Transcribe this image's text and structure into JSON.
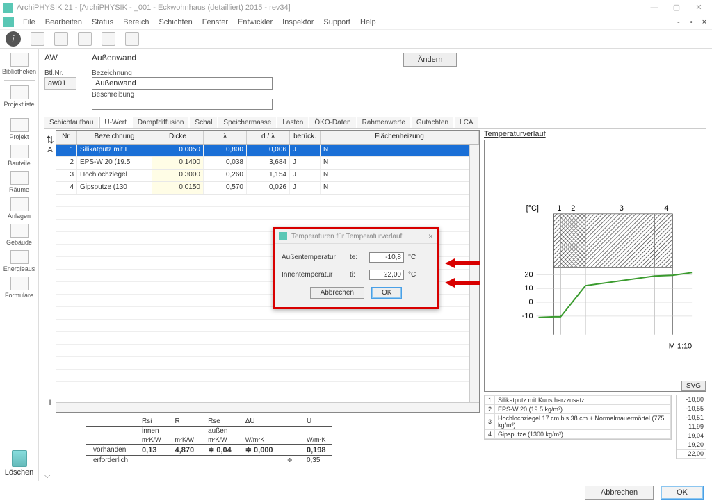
{
  "window": {
    "title": "ArchiPHYSIK 21 - [ArchiPHYSIK - _001 - Eckwohnhaus (detailliert) 2015 - rev34]"
  },
  "menu": [
    "File",
    "Bearbeiten",
    "Status",
    "Bereich",
    "Schichten",
    "Fenster",
    "Entwickler",
    "Inspektor",
    "Support",
    "Help"
  ],
  "leftnav": [
    {
      "label": "Bibliotheken"
    },
    {
      "label": "Projektliste"
    },
    {
      "label": "Projekt"
    },
    {
      "label": "Bauteile"
    },
    {
      "label": "Räume"
    },
    {
      "label": "Anlagen"
    },
    {
      "label": "Gebäude"
    },
    {
      "label": "Energieaus"
    },
    {
      "label": "Formulare"
    }
  ],
  "leftnav_delete": "Löschen",
  "form": {
    "code": "AW",
    "title": "Außenwand",
    "btlnr_label": "Btl.Nr.",
    "btlnr": "aw01",
    "bez_label": "Bezeichnung",
    "bez": "Außenwand",
    "beschr_label": "Beschreibung",
    "beschr": "",
    "change": "Ändern"
  },
  "tabs": [
    "Schichtaufbau",
    "U-Wert",
    "Dampfdiffusion",
    "Schal",
    "Speichermasse",
    "Lasten",
    "ÖKO-Daten",
    "Rahmenwerte",
    "Gutachten",
    "LCA"
  ],
  "active_tab": "U-Wert",
  "grid": {
    "side_top": "A",
    "side_bot": "I",
    "headers": [
      "Nr.",
      "Bezeichnung",
      "Dicke",
      "λ",
      "d / λ",
      "berück.",
      "Flächenheizung"
    ],
    "rows": [
      {
        "nr": "1",
        "bez": "Silikatputz mit I",
        "dicke": "0,0050",
        "lam": "0,800",
        "dl": "0,006",
        "ber": "J",
        "fl": "N",
        "sel": true
      },
      {
        "nr": "2",
        "bez": "EPS-W 20 (19.5",
        "dicke": "0,1400",
        "lam": "0,038",
        "dl": "3,684",
        "ber": "J",
        "fl": "N"
      },
      {
        "nr": "3",
        "bez": "Hochlochziegel",
        "dicke": "0,3000",
        "lam": "0,260",
        "dl": "1,154",
        "ber": "J",
        "fl": "N"
      },
      {
        "nr": "4",
        "bez": "Gipsputze (130",
        "dicke": "0,0150",
        "lam": "0,570",
        "dl": "0,026",
        "ber": "J",
        "fl": "N"
      }
    ]
  },
  "dialog": {
    "title": "Temperaturen für Temperaturverlauf",
    "rows": [
      {
        "label": "Außentemperatur",
        "key": "te:",
        "val": "-10,8",
        "unit": "°C"
      },
      {
        "label": "Innentemperatur",
        "key": "ti:",
        "val": "22,00",
        "unit": "°C"
      }
    ],
    "cancel": "Abbrechen",
    "ok": "OK"
  },
  "rightpane": {
    "title": "Temperaturverlauf",
    "svg": "SVG",
    "legend": [
      {
        "n": "1",
        "t": "Silikatputz mit Kunstharzzusatz"
      },
      {
        "n": "2",
        "t": "EPS-W 20 (19.5 kg/m³)"
      },
      {
        "n": "3",
        "t": "Hochlochziegel 17 cm bis 38 cm + Normalmauermörtel (775 kg/m³)"
      },
      {
        "n": "4",
        "t": "Gipsputze (1300 kg/m³)"
      }
    ],
    "values": [
      "-10,80",
      "-10,55",
      "-10,51",
      "11,99",
      "19,04",
      "19,20",
      "22,00"
    ]
  },
  "summary": {
    "head": [
      "",
      "Rsi",
      "R",
      "Rse",
      "ΔU",
      "",
      "U"
    ],
    "sub": [
      "",
      "innen",
      "",
      "außen",
      "",
      "",
      ""
    ],
    "unit": [
      "",
      "m²K/W",
      "m²K/W",
      "m²K/W",
      "W/m²K",
      "",
      "W/m²K"
    ],
    "vorh_label": "vorhanden",
    "vorh": [
      "≑",
      "0,13",
      "4,870",
      "≑  0,04",
      "≑  0,000",
      "",
      "0,198"
    ],
    "erf_label": "erforderlich",
    "erf": [
      "",
      "",
      "",
      "",
      "",
      "≑",
      "0,35"
    ]
  },
  "bottom": {
    "cancel": "Abbrechen",
    "ok": "OK"
  },
  "chart_data": {
    "type": "line",
    "title": "Temperaturverlauf",
    "xlabel": "",
    "ylabel": "[°C]",
    "scale": "M 1:10",
    "layer_numbers": [
      "1",
      "2",
      "3",
      "4"
    ],
    "x": [
      0,
      0.005,
      0.145,
      0.445,
      0.46,
      0.56
    ],
    "y": [
      -10.8,
      -10.55,
      -10.51,
      11.99,
      19.04,
      19.2
    ],
    "yticks": [
      -10,
      0,
      10,
      20
    ],
    "ylim": [
      -15,
      25
    ]
  }
}
